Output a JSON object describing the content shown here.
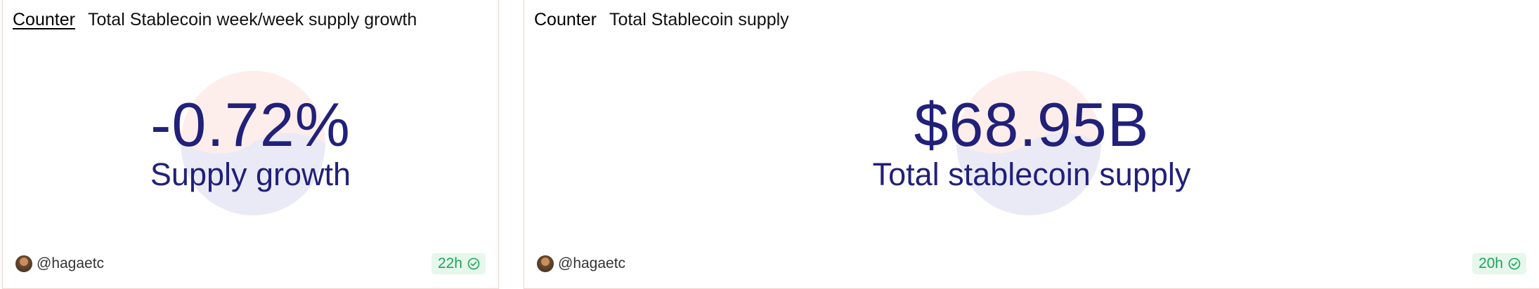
{
  "cards": [
    {
      "viz_type": "Counter",
      "query_title": "Total Stablecoin week/week supply growth",
      "value": "-0.72%",
      "label": "Supply growth",
      "author": "@hagaetc",
      "updated": "22h",
      "status_icon": "check-circle-icon"
    },
    {
      "viz_type": "Counter",
      "query_title": "Total Stablecoin supply",
      "value": "$68.95B",
      "label": "Total stablecoin supply",
      "author": "@hagaetc",
      "updated": "20h",
      "status_icon": "check-circle-icon"
    }
  ],
  "colors": {
    "value_text": "#21207a",
    "badge_bg": "#e6f7ec",
    "badge_text": "#1ea35a",
    "card_border": "#f3d3c9",
    "logo_top": "#fdeeec",
    "logo_bottom": "#eaeaf6"
  }
}
